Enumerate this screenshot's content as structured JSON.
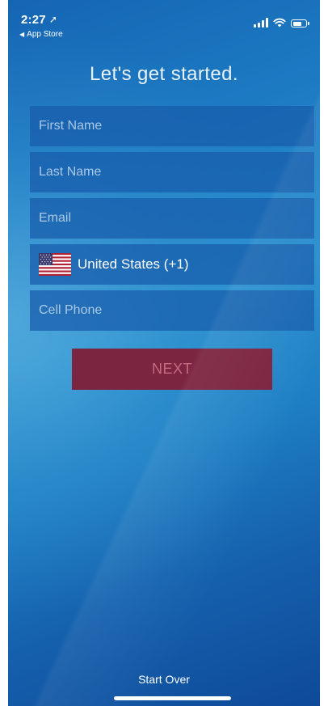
{
  "status_bar": {
    "time": "2:27",
    "location_icon": "location-arrow-icon",
    "back_label": "App Store"
  },
  "page": {
    "title": "Let's get started."
  },
  "form": {
    "first_name_placeholder": "First Name",
    "last_name_placeholder": "Last Name",
    "email_placeholder": "Email",
    "country_label": "United States (+1)",
    "country_flag_icon": "us-flag-icon",
    "cell_phone_placeholder": "Cell Phone"
  },
  "actions": {
    "next_label": "NEXT",
    "start_over_label": "Start Over"
  },
  "colors": {
    "background": "#1d7cc4",
    "field_fill": "#175caa",
    "next_button": "#7c2540",
    "text": "#ffffff"
  }
}
